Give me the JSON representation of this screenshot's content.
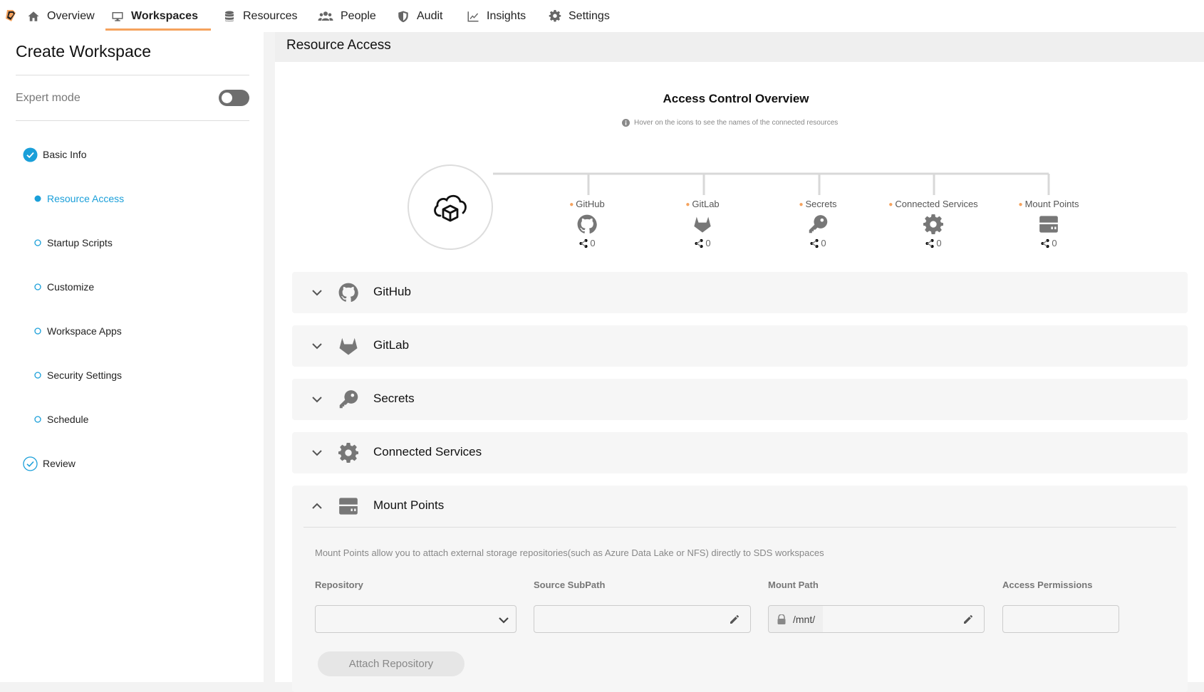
{
  "nav": {
    "items": [
      {
        "label": "Overview",
        "icon": "home-icon"
      },
      {
        "label": "Workspaces",
        "icon": "monitor-icon"
      },
      {
        "label": "Resources",
        "icon": "database-icon"
      },
      {
        "label": "People",
        "icon": "people-icon"
      },
      {
        "label": "Audit",
        "icon": "shield-icon"
      },
      {
        "label": "Insights",
        "icon": "chart-line-icon"
      },
      {
        "label": "Settings",
        "icon": "gear-icon"
      }
    ],
    "active": "Workspaces",
    "accent_color": "#f5a25d"
  },
  "sidebar": {
    "title": "Create Workspace",
    "expert_mode_label": "Expert mode",
    "expert_mode_on": false,
    "steps": [
      {
        "label": "Basic Info",
        "state": "done"
      },
      {
        "label": "Resource Access",
        "state": "current"
      },
      {
        "label": "Startup Scripts",
        "state": "pending"
      },
      {
        "label": "Customize",
        "state": "pending"
      },
      {
        "label": "Workspace Apps",
        "state": "pending"
      },
      {
        "label": "Security Settings",
        "state": "pending"
      },
      {
        "label": "Schedule",
        "state": "pending"
      },
      {
        "label": "Review",
        "state": "done-outline"
      }
    ],
    "active_color": "#1a9fd9"
  },
  "main": {
    "title": "Resource Access",
    "overview": {
      "title": "Access Control Overview",
      "hint": "Hover on the icons to see the names of the connected resources",
      "resources": [
        {
          "name": "GitHub",
          "icon": "github-icon",
          "count": "0"
        },
        {
          "name": "GitLab",
          "icon": "gitlab-icon",
          "count": "0"
        },
        {
          "name": "Secrets",
          "icon": "key-icon",
          "count": "0"
        },
        {
          "name": "Connected Services",
          "icon": "gear-icon",
          "count": "0"
        },
        {
          "name": "Mount Points",
          "icon": "storage-icon",
          "count": "0"
        }
      ]
    },
    "panels": [
      {
        "label": "GitHub",
        "icon": "github-icon",
        "expanded": false
      },
      {
        "label": "GitLab",
        "icon": "gitlab-icon",
        "expanded": false
      },
      {
        "label": "Secrets",
        "icon": "key-icon",
        "expanded": false
      },
      {
        "label": "Connected Services",
        "icon": "gear-icon",
        "expanded": false
      },
      {
        "label": "Mount Points",
        "icon": "storage-icon",
        "expanded": true
      }
    ],
    "mount_points": {
      "description": "Mount Points allow you to attach external storage repositories(such as Azure Data Lake or NFS) directly to SDS workspaces",
      "repository_label": "Repository",
      "repository_value": "",
      "source_subpath_label": "Source SubPath",
      "source_subpath_value": "",
      "mount_path_label": "Mount Path",
      "mount_path_prefix": "/mnt/",
      "mount_path_value": "",
      "access_permissions_label": "Access Permissions",
      "access_permissions_value": "",
      "attach_button": "Attach Repository"
    }
  }
}
